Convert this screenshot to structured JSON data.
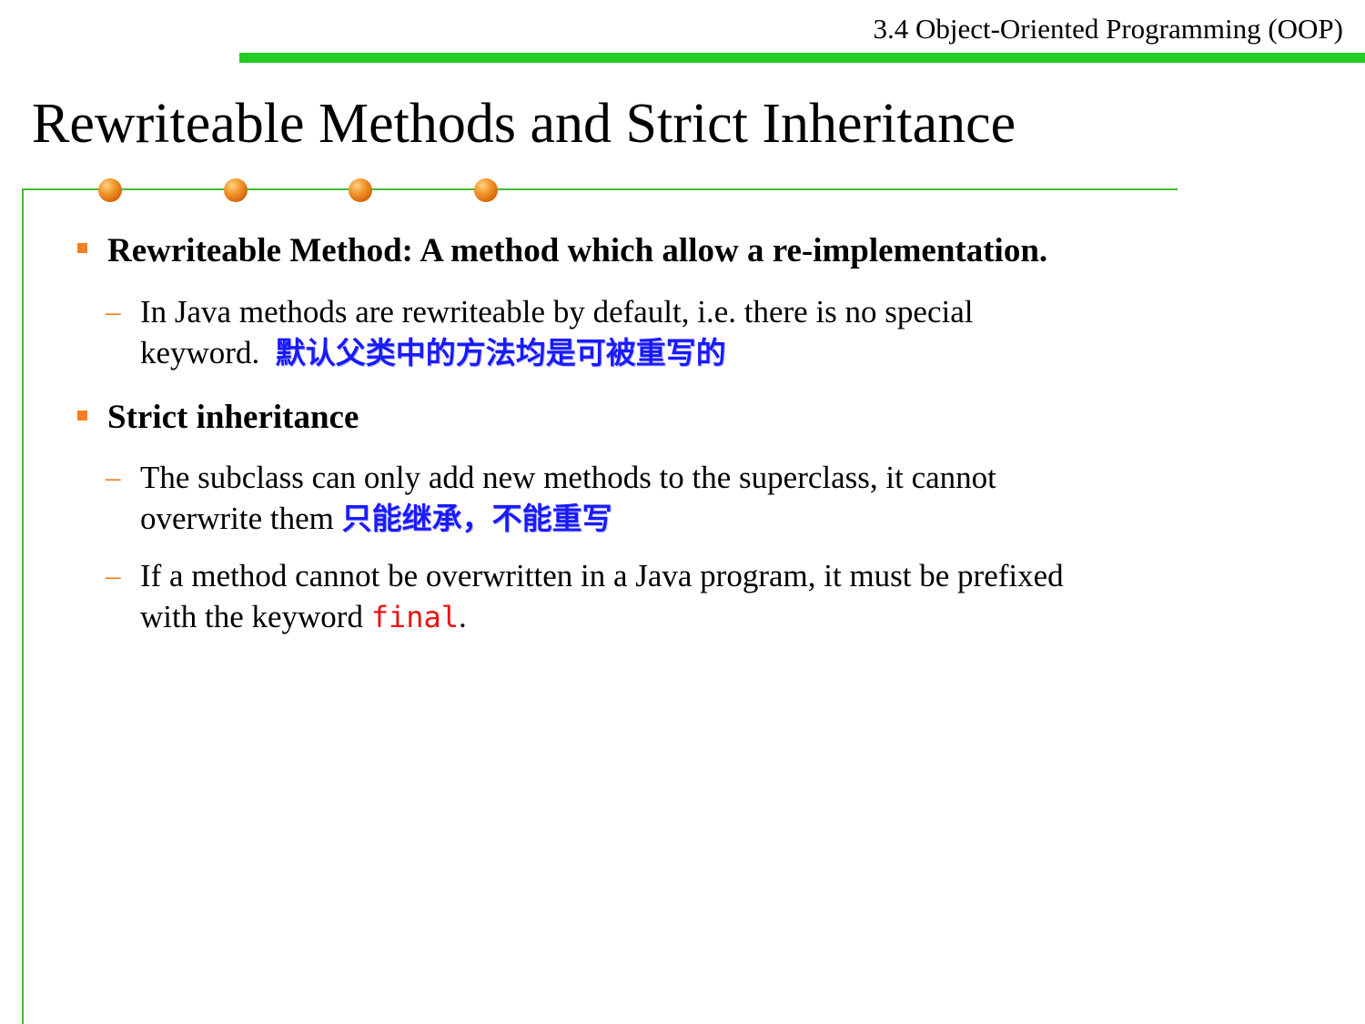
{
  "header": {
    "section": "3.4 Object-Oriented Programming (OOP)"
  },
  "title": "Rewriteable Methods and Strict Inheritance",
  "theme": {
    "accent_green": "#22cc22",
    "frame_green": "#44bb33",
    "bullet_orange": "#f57f20",
    "chinese_text_blue": "#1a1aff",
    "code_red": "#ee1111"
  },
  "bullets": [
    {
      "text": "Rewriteable Method: A method which allow a re-implementation.",
      "subs": [
        {
          "line1": "In Java methods are rewriteable by default, i.e. there is no special",
          "line2": "keyword.",
          "cn": "默认父类中的方法均是可被重写的"
        }
      ]
    },
    {
      "text": "Strict inheritance",
      "subs": [
        {
          "line1": "The subclass can only add new methods to the superclass, it cannot",
          "line2": "overwrite them",
          "cn": "只能继承，不能重写"
        },
        {
          "line1": "If a method cannot be overwritten in a Java program, it must be prefixed",
          "line2": "with the keyword",
          "code": "final",
          "end": "."
        }
      ]
    }
  ]
}
